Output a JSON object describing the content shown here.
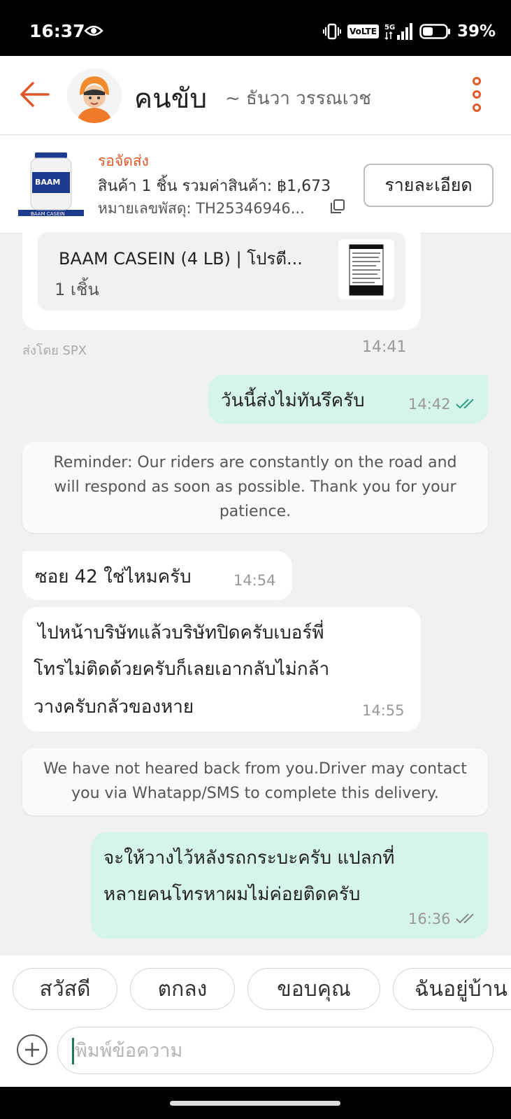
{
  "status_bar": {
    "time": "16:37",
    "network_badge": "VoLTE",
    "network_type": "5G",
    "battery": "39%"
  },
  "header": {
    "title": "คนขับ",
    "subtitle": "~ ธันวา วรรณเวช"
  },
  "order": {
    "status": "รอจัดส่ง",
    "summary": "สินค้า 1 ชิ้น รวมค่าสินค้า: ฿1,673",
    "tracking": "หมายเลขพัสดุ: TH25346946...",
    "detail_button": "รายละเอียด",
    "product_label": "BAAM CASEIN"
  },
  "messages": {
    "product_card": {
      "name": "BAAM CASEIN (4 LB) | โปรตี...",
      "qty": "1 เชิ้น",
      "sent_by": "ส่งโดย SPX",
      "time": "14:41"
    },
    "m1": {
      "text": "วันนี้ส่งไม่ทันรึครับ",
      "time": "14:42"
    },
    "reminder": "Reminder: Our riders are constantly on the road and will respond as soon as possible. Thank you for your patience.",
    "m2": {
      "text": "ซอย 42 ใช่ไหมครับ",
      "time": "14:54"
    },
    "m3": {
      "line1": " ไปหน้าบริษัทแล้วบริษัทปิดครับเบอร์พี่",
      "line2": "โทรไม่ติดด้วยครับก็เลยเอากลับไม่กล้า",
      "line3": "วางครับกลัวของหาย",
      "time": "14:55"
    },
    "notice": "We have not heared back from you.Driver may contact you via Whatapp/SMS to complete this delivery.",
    "m4": {
      "line1": "จะให้วางไว้หลังรถกระบะครับ แปลกที่",
      "line2": "หลายคนโทรหาผมไม่ค่อยติดครับ",
      "time": "16:36"
    }
  },
  "quick_replies": [
    "สวัสดี",
    "ตกลง",
    "ขอบคุณ",
    "ฉันอยู่บ้าน"
  ],
  "composer": {
    "placeholder": "พิมพ์ข้อความ"
  },
  "colors": {
    "accent": "#e0582a",
    "outgoing_bubble": "#d5f4ea",
    "read_check": "#2f9e84"
  }
}
